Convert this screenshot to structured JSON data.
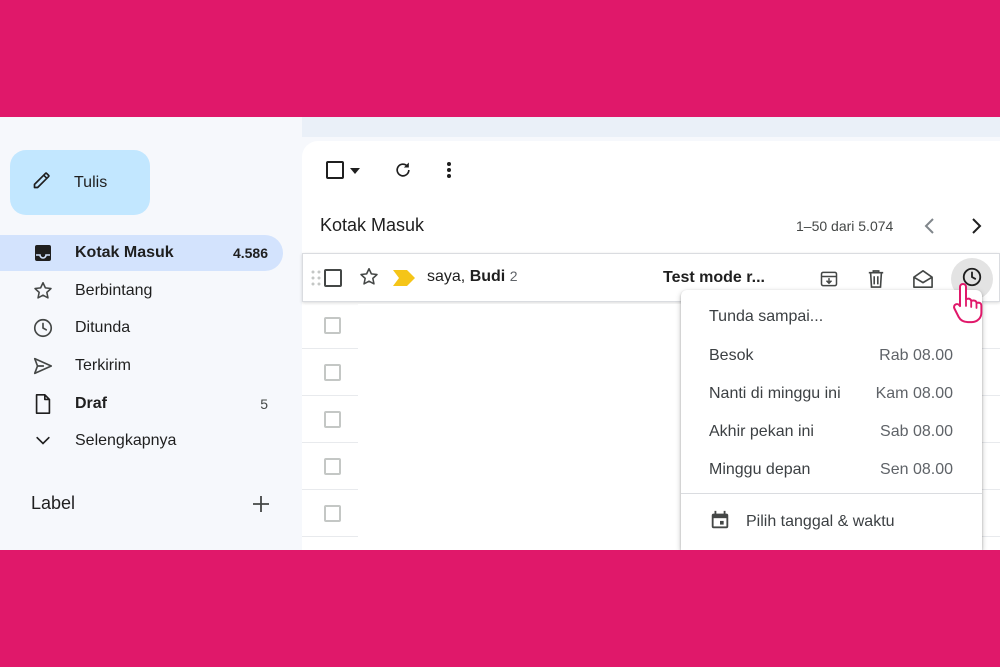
{
  "sidebar": {
    "compose_label": "Tulis",
    "items": [
      {
        "label": "Kotak Masuk",
        "count": "4.586"
      },
      {
        "label": "Berbintang",
        "count": ""
      },
      {
        "label": "Ditunda",
        "count": ""
      },
      {
        "label": "Terkirim",
        "count": ""
      },
      {
        "label": "Draf",
        "count": "5"
      },
      {
        "label": "Selengkapnya",
        "count": ""
      }
    ],
    "label_heading": "Label"
  },
  "main": {
    "title": "Kotak Masuk",
    "pagination": "1–50 dari 5.074"
  },
  "email": {
    "sender_prefix": "saya, ",
    "sender_bold": "Budi",
    "thread_count": "2",
    "subject": "Test mode r..."
  },
  "snooze_menu": {
    "heading": "Tunda sampai...",
    "options": [
      {
        "label": "Besok",
        "when": "Rab 08.00"
      },
      {
        "label": "Nanti di minggu ini",
        "when": "Kam 08.00"
      },
      {
        "label": "Akhir pekan ini",
        "when": "Sab 08.00"
      },
      {
        "label": "Minggu depan",
        "when": "Sen 08.00"
      }
    ],
    "pick_label": "Pilih tanggal & waktu"
  },
  "colors": {
    "frame": "#E0186A",
    "compose_bg": "#C2E7FF",
    "active_nav_bg": "#D3E3FD",
    "important_marker": "#F5C518"
  },
  "icons": [
    "pencil-icon",
    "inbox-icon",
    "star-icon",
    "clock-icon",
    "send-icon",
    "draft-icon",
    "chevron-down-icon",
    "plus-icon",
    "checkbox-icon",
    "caret-down-icon",
    "refresh-icon",
    "more-vert-icon",
    "chevron-left-icon",
    "chevron-right-icon",
    "drag-handle-icon",
    "important-marker-icon",
    "archive-icon",
    "trash-icon",
    "mark-read-icon",
    "calendar-icon",
    "hand-cursor-icon"
  ]
}
